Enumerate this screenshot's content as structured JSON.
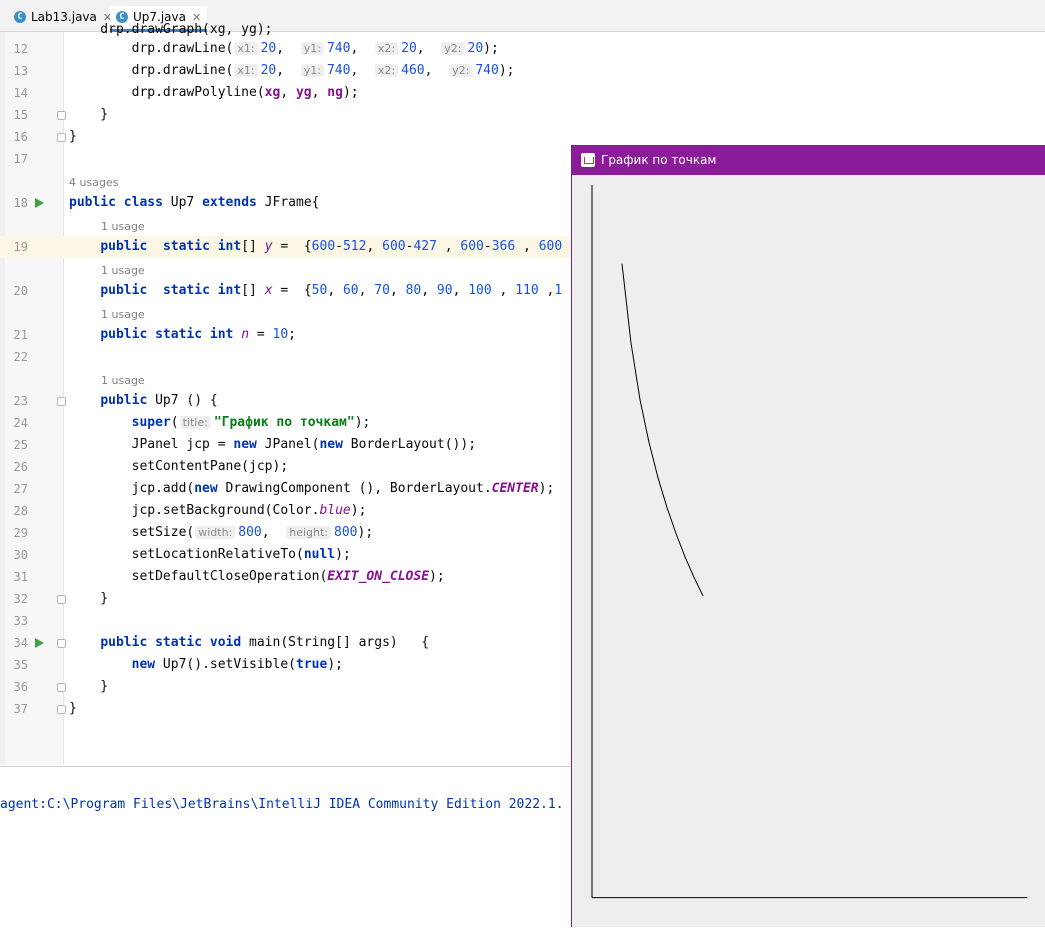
{
  "tabs": [
    {
      "label": "Lab13.java",
      "icon": "java-class-icon",
      "active": false
    },
    {
      "label": "Up7.java",
      "icon": "java-class-icon",
      "active": true
    }
  ],
  "editor": {
    "line_numbers": [
      "12",
      "13",
      "14",
      "15",
      "16",
      "17",
      "18",
      "19",
      "20",
      "21",
      "22",
      "23",
      "24",
      "25",
      "26",
      "27",
      "28",
      "29",
      "30",
      "31",
      "32",
      "33",
      "34",
      "35",
      "36",
      "37"
    ],
    "usages": {
      "class": "4 usages",
      "y": "1 usage",
      "x": "1 usage",
      "n": "1 usage",
      "ctor": "1 usage"
    },
    "hints": {
      "x1": "x1:",
      "y1": "y1:",
      "x2": "x2:",
      "y2": "y2:",
      "title": "title:",
      "width": "width:",
      "height": "height:"
    }
  },
  "console": {
    "text": "agent:C:\\Program Files\\JetBrains\\IntelliJ IDEA Community Edition 2022.1."
  },
  "java_window": {
    "title": "График по точкам",
    "title_color": "#8b1c99"
  },
  "chart_data": {
    "type": "line",
    "series": [
      {
        "x": [
          50,
          60,
          70,
          80,
          90,
          100,
          110,
          120,
          130,
          140
        ],
        "y": [
          88,
          173,
          234,
          280,
          318,
          350,
          378,
          403,
          425,
          445
        ]
      }
    ]
  }
}
